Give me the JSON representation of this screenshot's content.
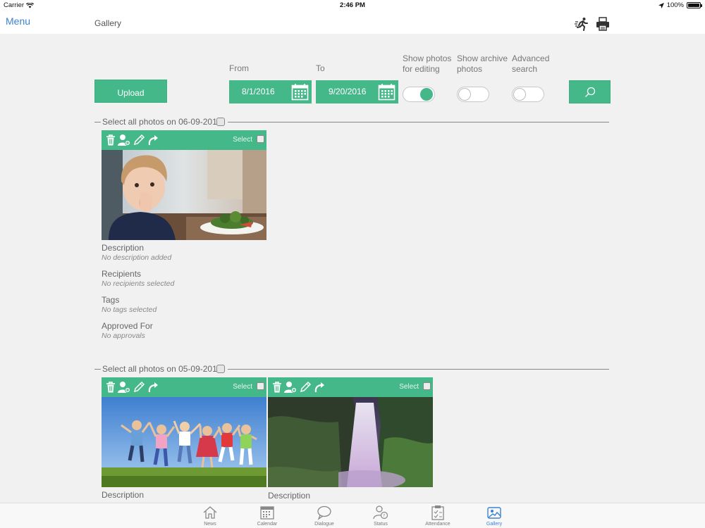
{
  "status_bar": {
    "carrier": "Carrier",
    "time": "2:46 PM",
    "battery": "100%"
  },
  "nav": {
    "menu_label": "Menu",
    "title": "Gallery"
  },
  "filters": {
    "upload_label": "Upload",
    "from_label": "From",
    "from_value": "8/1/2016",
    "to_label": "To",
    "to_value": "9/20/2016",
    "show_editing_label_1": "Show photos",
    "show_editing_label_2": "for editing",
    "show_editing_on": true,
    "show_archive_label_1": "Show archive",
    "show_archive_label_2": "photos",
    "show_archive_on": false,
    "advanced_label_1": "Advanced",
    "advanced_label_2": "search",
    "advanced_on": false
  },
  "groups": [
    {
      "header": "Select all photos on 06-09-2016",
      "photos": [
        {
          "select_label": "Select",
          "image": "child-eating-photo",
          "description_label": "Description",
          "description_value": "No description added",
          "recipients_label": "Recipients",
          "recipients_value": "No recipients selected",
          "tags_label": "Tags",
          "tags_value": "No tags selected",
          "approved_label": "Approved For",
          "approved_value": "No approvals"
        }
      ]
    },
    {
      "header": "Select all photos on 05-09-2016",
      "photos": [
        {
          "select_label": "Select",
          "image": "children-jumping-photo",
          "description_label": "Description"
        },
        {
          "select_label": "Select",
          "image": "waterfall-photo",
          "description_label": "Description"
        }
      ]
    }
  ],
  "tabs": [
    {
      "label": "News",
      "icon": "house-icon",
      "active": false
    },
    {
      "label": "Calendar",
      "icon": "calendar-icon",
      "active": false
    },
    {
      "label": "Dialogue",
      "icon": "speech-bubble-icon",
      "active": false
    },
    {
      "label": "Status",
      "icon": "status-person-icon",
      "active": false
    },
    {
      "label": "Attendance",
      "icon": "attendance-icon",
      "active": false
    },
    {
      "label": "Gallery",
      "icon": "gallery-icon",
      "active": true
    }
  ],
  "colors": {
    "accent": "#45b88a",
    "link": "#3c82d4",
    "background": "#f1f1f2"
  }
}
